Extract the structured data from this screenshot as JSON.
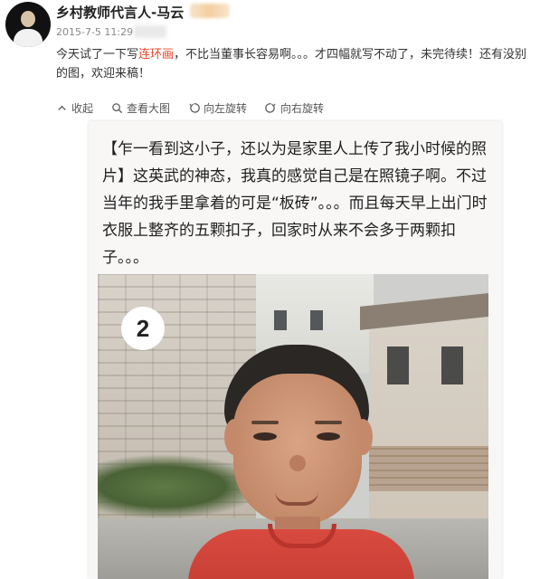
{
  "post": {
    "username": "乡村教师代言人-马云",
    "date": "2015-7-5 11:29",
    "text_before": "今天试了一下写",
    "text_highlight": "连环画",
    "text_after": "，不比当董事长容易啊。。。才四幅就写不动了，未完待续！还有没别的图，欢迎来稿！"
  },
  "toolbar": {
    "collapse_label": "收起",
    "view_large_label": "查看大图",
    "rotate_left_label": "向左旋转",
    "rotate_right_label": "向右旋转"
  },
  "image": {
    "caption": "【乍一看到这小子，还以为是家里人上传了我小时候的照片】这英武的神态，我真的感觉自己是在照镜子啊。不过当年的我手里拿着的可是“板砖”。。。而且每天早上出门时衣服上整齐的五颗扣子，回家时从来不会多于两颗扣子。。。",
    "panel_number": "2"
  },
  "colors": {
    "highlight": "#e8442a",
    "text": "#333333",
    "muted": "#888888"
  }
}
